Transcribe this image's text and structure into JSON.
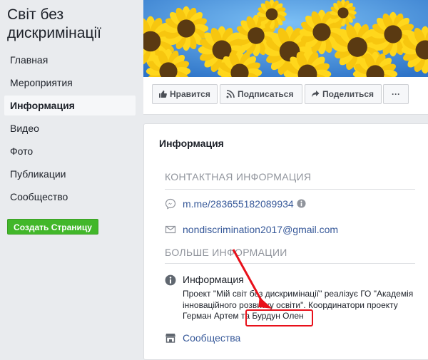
{
  "page": {
    "title": "Світ без дискримінації"
  },
  "sidebar": {
    "items": [
      {
        "label": "Главная",
        "active": false
      },
      {
        "label": "Мероприятия",
        "active": false
      },
      {
        "label": "Информация",
        "active": true
      },
      {
        "label": "Видео",
        "active": false
      },
      {
        "label": "Фото",
        "active": false
      },
      {
        "label": "Публикации",
        "active": false
      },
      {
        "label": "Сообщество",
        "active": false
      }
    ],
    "create_page_label": "Создать Страницу"
  },
  "actions": {
    "like_label": "Нравится",
    "subscribe_label": "Подписаться",
    "share_label": "Поделиться",
    "more_label": "···"
  },
  "info": {
    "title": "Информация",
    "contact_heading": "КОНТАКТНАЯ ИНФОРМАЦИЯ",
    "messenger_link": "m.me/283655182089934",
    "email": "nondiscrimination2017@gmail.com",
    "more_heading": "БОЛЬШЕ ИНФОРМАЦИИ",
    "info_label": "Информация",
    "description": "Проект \"Мій світ без дискримінації\" реалізує ГО \"Академія інноваційного розвитку освіти\". Координатори проекту Герман Артем та Бурдун Олен",
    "communities_label": "Сообщества"
  },
  "colors": {
    "link": "#365899",
    "create_button": "#42b72a",
    "annotation": "#e8101a",
    "sidebar_active_bg": "#f6f7f9"
  }
}
